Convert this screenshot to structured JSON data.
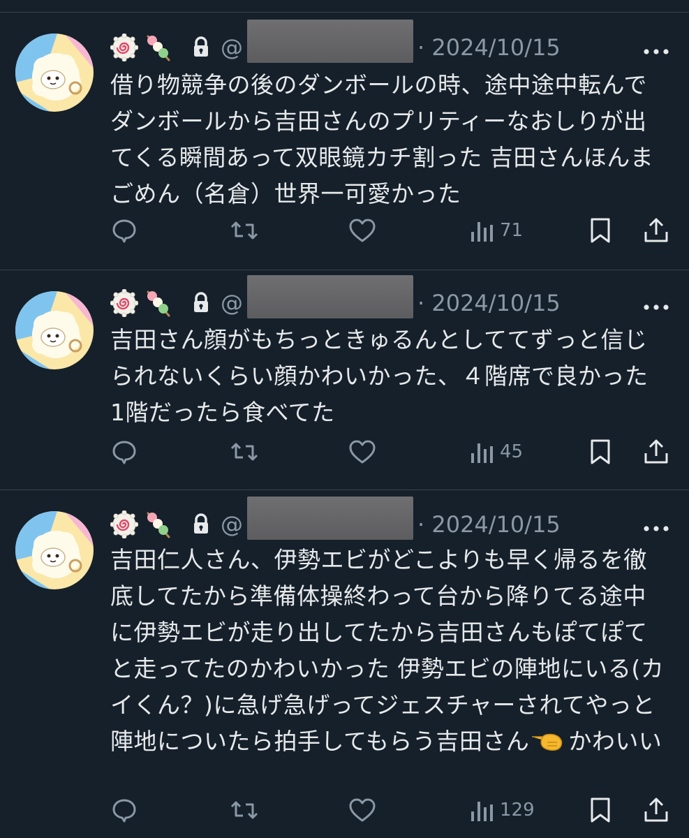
{
  "tweets": [
    {
      "at_sign": "@",
      "date": "· 2024/10/15",
      "text": "借り物競争の後のダンボールの時、途中途中転んでダンボールから吉田さんのプリティーなおしりが出てくる瞬間あって双眼鏡カチ割った 吉田さんほんまごめん（名倉）世界一可愛かった",
      "views": "71"
    },
    {
      "at_sign": "@",
      "date": "· 2024/10/15",
      "text": "吉田さん顔がもちっときゅるんとしててずっと信じられないくらい顔かわいかった、４階席で良かった 1階だったら食べてた",
      "views": "45"
    },
    {
      "at_sign": "@",
      "date": "· 2024/10/15",
      "text_before_emoji": "吉田仁人さん、伊勢エビがどこよりも早く帰るを徹底してたから準備体操終わって台から降りてる途中に伊勢エビが走り出してたから吉田さんもぽてぽてと走ってたのかわいかった 伊勢エビの陣地にいる(カイくん？)に急げ急げってジェスチャーされてやっと陣地についたら拍手してもらう吉田さん",
      "text_after_emoji": "かわいい",
      "inline_emoji": "pointing-hand-icon",
      "views": "129"
    }
  ],
  "icons": {
    "name_emojis": [
      "naruto-icon",
      "dango-icon",
      "lock-icon"
    ],
    "actions": [
      "reply-icon",
      "retweet-icon",
      "like-icon",
      "views-icon",
      "bookmark-icon",
      "share-icon"
    ],
    "more": "more-icon",
    "avatar": "sheep-avatar"
  },
  "colors": {
    "background": "#15202b",
    "text": "#e7e9ea",
    "secondary": "#8b98a5",
    "divider": "#38444d"
  }
}
